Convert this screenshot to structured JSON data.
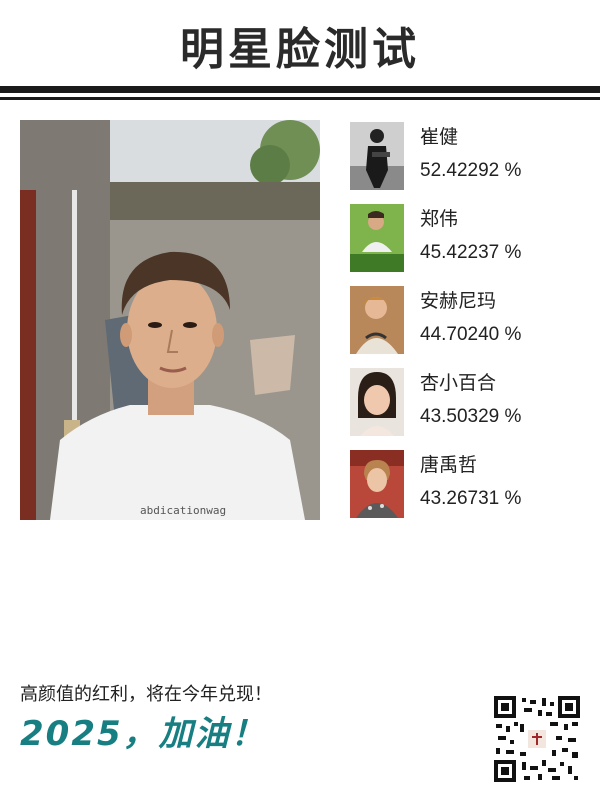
{
  "header": {
    "title": "明星脸测试"
  },
  "main_photo": {
    "shirt_text": "abdicationwag"
  },
  "matches": [
    {
      "name": "崔健",
      "score": "52.42292 %"
    },
    {
      "name": "郑伟",
      "score": "45.42237 %"
    },
    {
      "name": "安赫尼玛",
      "score": "44.70240 %"
    },
    {
      "name": "杏小百合",
      "score": "43.50329 %"
    },
    {
      "name": "唐禹哲",
      "score": "43.26731 %"
    }
  ],
  "footer": {
    "slogan": "高颜值的红利，将在今年兑现！",
    "cheer": "2025，加油！",
    "accent_color": "#177f82"
  },
  "icons": {
    "qr": "qr-code-icon"
  }
}
